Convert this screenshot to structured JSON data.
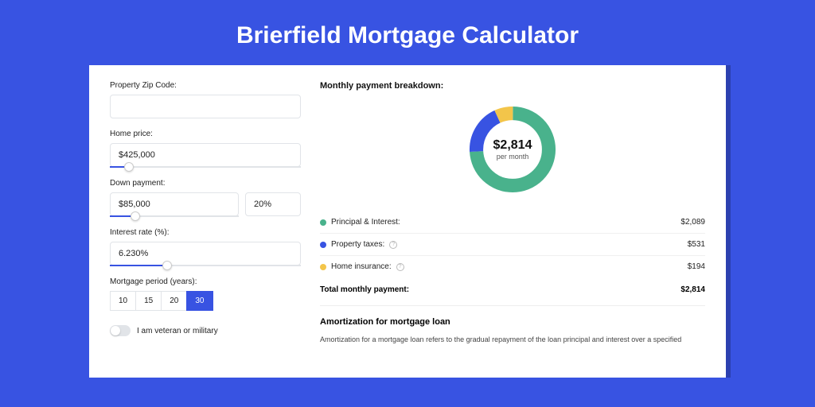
{
  "title": "Brierfield Mortgage Calculator",
  "form": {
    "zip_label": "Property Zip Code:",
    "zip_value": "",
    "price_label": "Home price:",
    "price_value": "$425,000",
    "price_slider_pct": 10,
    "down_label": "Down payment:",
    "down_value": "$85,000",
    "down_pct_value": "20%",
    "down_slider_pct": 20,
    "rate_label": "Interest rate (%):",
    "rate_value": "6.230%",
    "rate_slider_pct": 30,
    "period_label": "Mortgage period (years):",
    "periods": [
      "10",
      "15",
      "20",
      "30"
    ],
    "period_active": 3,
    "veteran_label": "I am veteran or military"
  },
  "breakdown": {
    "heading": "Monthly payment breakdown:",
    "donut_amount": "$2,814",
    "donut_sub": "per month",
    "items": [
      {
        "label": "Principal & Interest:",
        "value": "$2,089",
        "color": "#49b28c",
        "pct": 74,
        "info": false
      },
      {
        "label": "Property taxes:",
        "value": "$531",
        "color": "#3853e2",
        "pct": 19,
        "info": true
      },
      {
        "label": "Home insurance:",
        "value": "$194",
        "color": "#f3c54a",
        "pct": 7,
        "info": true
      }
    ],
    "total_label": "Total monthly payment:",
    "total_value": "$2,814"
  },
  "amort": {
    "heading": "Amortization for mortgage loan",
    "text": "Amortization for a mortgage loan refers to the gradual repayment of the loan principal and interest over a specified"
  }
}
